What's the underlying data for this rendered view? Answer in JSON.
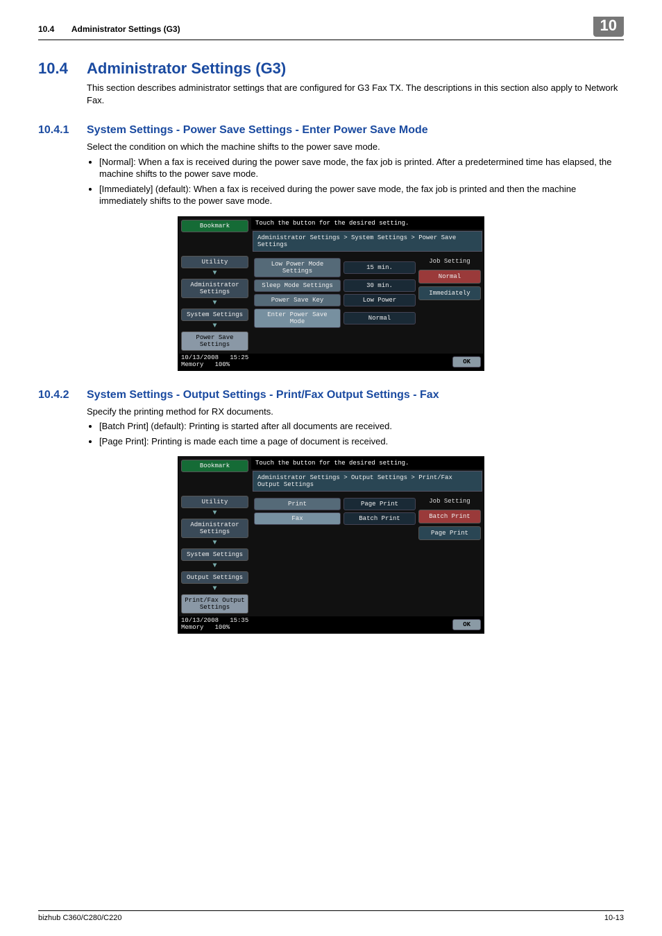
{
  "header": {
    "section_number": "10.4",
    "section_title": "Administrator Settings (G3)",
    "chapter_number": "10"
  },
  "s104": {
    "num": "10.4",
    "title": "Administrator Settings (G3)",
    "intro": "This section describes administrator settings that are configured for G3 Fax TX. The descriptions in this section also apply to Network Fax."
  },
  "s1041": {
    "num": "10.4.1",
    "title": "System Settings - Power Save Settings - Enter Power Save Mode",
    "intro": "Select the condition on which the machine shifts to the power save mode.",
    "b1": "[Normal]: When a fax is received during the power save mode, the fax job is printed. After a predetermined time has elapsed, the machine shifts to the power save mode.",
    "b2": "[Immediately] (default): When a fax is received during the power save mode, the fax job is printed and then the machine immediately shifts to the power save mode."
  },
  "s1042": {
    "num": "10.4.2",
    "title": "System Settings - Output Settings - Print/Fax Output Settings - Fax",
    "intro": "Specify the printing method for RX documents.",
    "b1": "[Batch Print] (default): Printing is started after all documents are received.",
    "b2": "[Page Print]: Printing is made each time a page of document is received."
  },
  "panel1": {
    "prompt": "Touch the button for the desired setting.",
    "breadcrumb": "Administrator Settings > System Settings > Power Save Settings",
    "left": {
      "bookmark": "Bookmark",
      "utility": "Utility",
      "admin": "Administrator Settings",
      "sys": "System Settings",
      "leaf": "Power Save Settings"
    },
    "rows": {
      "r1k": "Low Power Mode Settings",
      "r1v": "15 min.",
      "r2k": "Sleep Mode Settings",
      "r2v": "30 min.",
      "r3k": "Power Save Key",
      "r3v": "Low Power",
      "r4k": "Enter Power Save Mode",
      "r4v": "Normal"
    },
    "side": {
      "hdr": "Job Setting",
      "o1": "Normal",
      "o2": "Immediately"
    },
    "status": {
      "date": "10/13/2008",
      "time": "15:25",
      "meml": "Memory",
      "memv": "100%",
      "ok": "OK"
    }
  },
  "panel2": {
    "prompt": "Touch the button for the desired setting.",
    "breadcrumb": "Administrator Settings > Output Settings > Print/Fax Output Settings",
    "left": {
      "bookmark": "Bookmark",
      "utility": "Utility",
      "admin": "Administrator Settings",
      "sys": "System Settings",
      "out": "Output Settings",
      "leaf": "Print/Fax Output Settings"
    },
    "rows": {
      "r1k": "Print",
      "r1v": "Page Print",
      "r2k": "Fax",
      "r2v": "Batch Print"
    },
    "side": {
      "hdr": "Job Setting",
      "o1": "Batch Print",
      "o2": "Page Print"
    },
    "status": {
      "date": "10/13/2008",
      "time": "15:35",
      "meml": "Memory",
      "memv": "100%",
      "ok": "OK"
    }
  },
  "footer": {
    "model": "bizhub C360/C280/C220",
    "page": "10-13"
  }
}
